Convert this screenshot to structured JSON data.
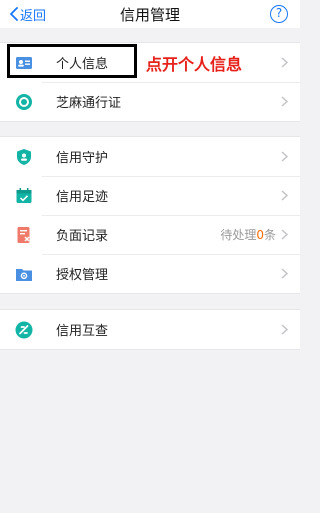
{
  "nav": {
    "back_label": "返回",
    "title": "信用管理",
    "help_label": "?"
  },
  "group1": [
    {
      "label": "个人信息",
      "icon": "id-card-icon"
    },
    {
      "label": "芝麻通行证",
      "icon": "sesame-pass-icon"
    }
  ],
  "group2": [
    {
      "label": "信用守护",
      "icon": "shield-icon"
    },
    {
      "label": "信用足迹",
      "icon": "calendar-check-icon"
    },
    {
      "label": "负面记录",
      "icon": "document-x-icon",
      "trail_prefix": "待处理",
      "trail_count": "0",
      "trail_suffix": "条"
    },
    {
      "label": "授权管理",
      "icon": "folder-gear-icon"
    }
  ],
  "group3": [
    {
      "label": "信用互查",
      "icon": "mutual-check-icon"
    }
  ],
  "annotation": {
    "text": "点开个人信息"
  },
  "colors": {
    "accent": "#1677ff",
    "teal": "#12b5a5",
    "annotation": "#e8201a",
    "count": "#ff6a00"
  }
}
